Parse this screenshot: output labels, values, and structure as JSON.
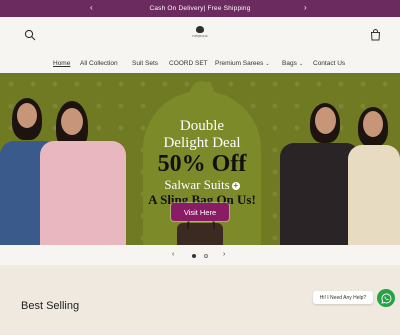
{
  "announcement": {
    "text": "Cash On Delivery| Free Shipping",
    "prev_arrow": "‹",
    "next_arrow": "›"
  },
  "header": {
    "logo_text": "ISHQBOOK",
    "icons": {
      "search": "search-icon",
      "cart": "cart-icon"
    }
  },
  "nav": {
    "items": [
      {
        "label": "Home",
        "active": true
      },
      {
        "label": "All Collection"
      },
      {
        "label": "Suit Sets"
      },
      {
        "label": "COORD SET"
      },
      {
        "label": "Premium Sarees",
        "dropdown": true
      },
      {
        "label": "Bags",
        "dropdown": true
      },
      {
        "label": "Contact Us"
      }
    ],
    "caret": "⌄"
  },
  "hero": {
    "line1": "Double",
    "line2": "Delight Deal",
    "line3": "50% Off",
    "line4": "Salwar Suits",
    "line5": "A Sling Bag On Us!",
    "plus": "+",
    "button_label": "Visit Here"
  },
  "carousel": {
    "prev": "‹",
    "next": "›"
  },
  "section": {
    "title": "Best Selling"
  },
  "chat": {
    "label": "Hi! I Need Any Help?",
    "icon": "whatsapp-icon"
  },
  "colors": {
    "announcement_bg": "#6b2b5e",
    "hero_bg": "#6f7a22",
    "button_bg": "#8a1c66",
    "whatsapp": "#25a244"
  }
}
